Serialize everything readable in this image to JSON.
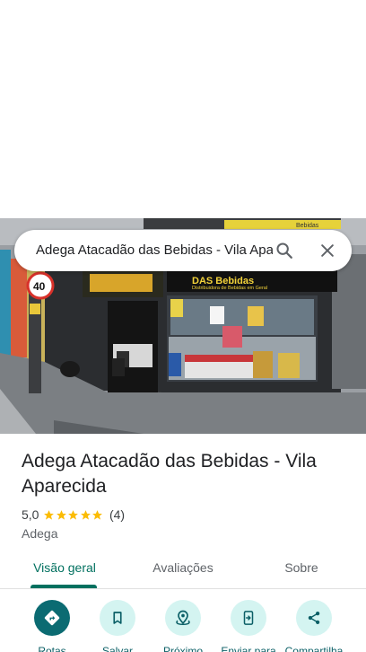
{
  "search": {
    "query": "Adega Atacadão das Bebidas - Vila Aparecida"
  },
  "photo": {
    "store_sign_top": "DAS Bebidas",
    "store_sign_sub": "Distribuidora de Bebidas em Geral",
    "speed_limit": "40",
    "banner_top": "Bebidas"
  },
  "place": {
    "title": "Adega Atacadão das Bebidas - Vila Aparecida",
    "rating": "5,0",
    "stars": 5,
    "reviews": "(4)",
    "category": "Adega"
  },
  "tabs": [
    {
      "label": "Visão geral"
    },
    {
      "label": "Avaliações"
    },
    {
      "label": "Sobre"
    }
  ],
  "actions": [
    {
      "label": "Rotas",
      "icon": "directions-icon"
    },
    {
      "label": "Salvar",
      "icon": "bookmark-icon"
    },
    {
      "label": "Próximo",
      "icon": "nearby-icon"
    },
    {
      "label": "Enviar para",
      "icon": "send-to-phone-icon"
    },
    {
      "label": "Compartilha",
      "icon": "share-icon"
    }
  ],
  "colors": {
    "accent": "#00705f",
    "primary_action": "#0b6b72",
    "secondary_action": "#d4f4f1",
    "star": "#fbbc04"
  }
}
